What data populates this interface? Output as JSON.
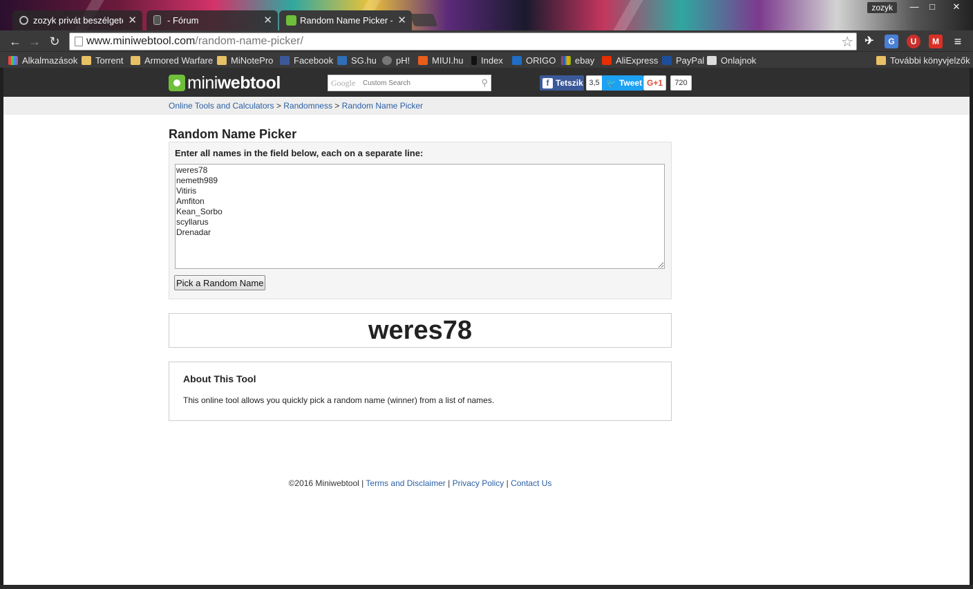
{
  "browser": {
    "tabs": [
      {
        "label": "zozyk privát beszélgetései",
        "active": false
      },
      {
        "label": "- Fórum",
        "active": false
      },
      {
        "label": "Random Name Picker - Q",
        "active": true
      }
    ],
    "user": "zozyk",
    "window_controls": {
      "minimize": "—",
      "maximize": "□",
      "close": "✕"
    },
    "url": {
      "domain": "www.miniwebtool.com",
      "path": "/random-name-picker/"
    },
    "bookmarks": [
      {
        "label": "Alkalmazások",
        "icon": "apps-grid-icon"
      },
      {
        "label": "Torrent",
        "icon": "folder-icon"
      },
      {
        "label": "Armored Warfare",
        "icon": "folder-icon"
      },
      {
        "label": "MiNotePro",
        "icon": "folder-icon"
      },
      {
        "label": "Facebook",
        "icon": "facebook-icon"
      },
      {
        "label": "SG.hu",
        "icon": "sg-icon"
      },
      {
        "label": "pH!",
        "icon": "ph-icon"
      },
      {
        "label": "MIUI.hu",
        "icon": "miui-icon"
      },
      {
        "label": "Index",
        "icon": "index-icon"
      },
      {
        "label": "ORIGO",
        "icon": "origo-icon"
      },
      {
        "label": "ebay",
        "icon": "ebay-icon"
      },
      {
        "label": "AliExpress",
        "icon": "aliexpress-icon"
      },
      {
        "label": "PayPal",
        "icon": "paypal-icon"
      },
      {
        "label": "Onlajnok",
        "icon": "onlajnok-icon"
      }
    ],
    "other_bookmarks": "További könyvjelzők"
  },
  "site": {
    "logo": {
      "mini": "mini",
      "bold": "webtool"
    },
    "search_placeholder": "Custom Search",
    "search_brand": "Google",
    "social": {
      "facebook_label": "Tetszik",
      "facebook_count": "3,5",
      "tweet_label": "Tweet",
      "gplus_label": "G+1",
      "gplus_count": "720"
    },
    "breadcrumb": {
      "item1": "Online Tools and Calculators",
      "sep": ">",
      "item2": "Randomness",
      "item3": "Random Name Picker"
    }
  },
  "tool": {
    "title": "Random Name Picker",
    "instructions": "Enter all names in the field below, each on a separate line:",
    "names": "weres78\nnemeth989\nVitiris\nAmfiton\nKean_Sorbo\nscyllarus\nDrenadar",
    "button_label": "Pick a Random Name",
    "result": "weres78"
  },
  "about": {
    "title": "About This Tool",
    "text": "This online tool allows you quickly pick a random name (winner) from a list of names."
  },
  "footer": {
    "copyright": "©2016 Miniwebtool",
    "sep": "|",
    "terms": "Terms and Disclaimer",
    "privacy": "Privacy Policy",
    "contact": "Contact Us"
  },
  "colors": {
    "header_bg": "#2f2f2f",
    "link": "#2a5fa3",
    "logo_green": "#6fbf3a",
    "facebook": "#3b5998",
    "twitter": "#1da1f2",
    "gplus": "#dd4b39"
  }
}
